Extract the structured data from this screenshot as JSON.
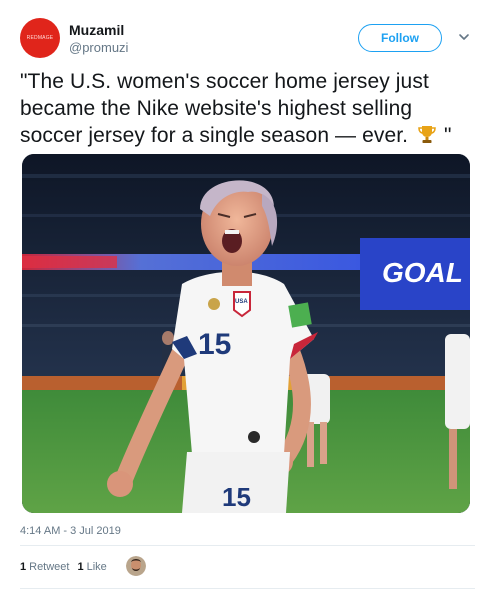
{
  "user": {
    "name": "Muzamil",
    "handle": "@promuzi",
    "avatar_text": "REDMAGE",
    "avatar_color": "#e0251b"
  },
  "follow_label": "Follow",
  "tweet": {
    "text": "\"The U.S. women's soccer home jersey just became the Nike website's highest selling soccer jersey for a single season — ever.",
    "text_end": " \""
  },
  "media": {
    "board_text": "GOAL",
    "jersey_number": "15",
    "crest_text": "USA"
  },
  "timestamp": "4:14 AM - 3 Jul 2019",
  "stats": {
    "retweets_count": "1",
    "retweets_label": "Retweet",
    "likes_count": "1",
    "likes_label": "Like"
  },
  "colors": {
    "accent": "#1da1f2",
    "text": "#14171a",
    "muted": "#657786"
  }
}
